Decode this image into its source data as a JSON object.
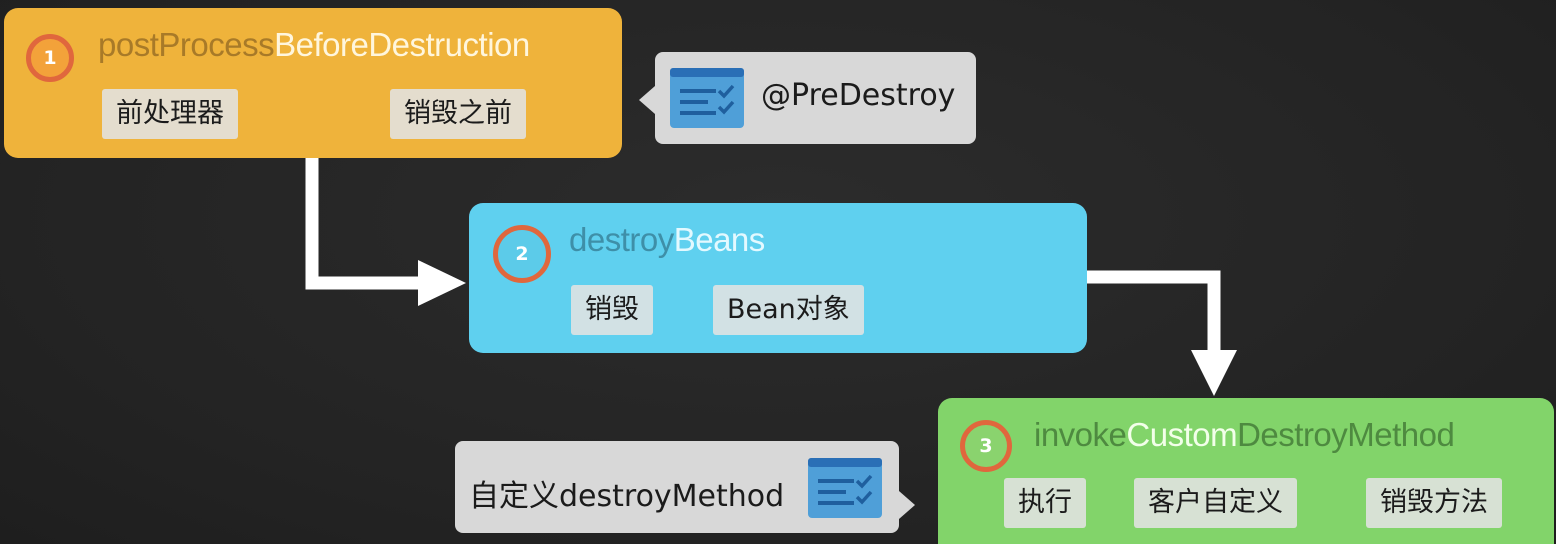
{
  "steps": [
    {
      "number": "1",
      "title_parts": [
        "post",
        "Process",
        "Before",
        "Destruction"
      ],
      "tags": [
        "前处理器",
        "销毁之前"
      ]
    },
    {
      "number": "2",
      "title_parts": [
        "destroy",
        "Beans"
      ],
      "tags": [
        "销毁",
        "Bean对象"
      ]
    },
    {
      "number": "3",
      "title_parts": [
        "invoke",
        "Custom",
        "Destroy",
        "Method"
      ],
      "tags": [
        "执行",
        "客户自定义",
        "销毁方法"
      ]
    }
  ],
  "notes": {
    "predestroy": "@PreDestroy",
    "custom_destroy": "自定义destroyMethod"
  },
  "icons": {
    "note_icon": "checklist-document-icon"
  },
  "colors": {
    "step1": "#efb33b",
    "step2": "#5fd0ef",
    "step3": "#82d46a",
    "badge_ring": "#e0673d",
    "arrow": "#ffffff",
    "background": "#262626"
  }
}
